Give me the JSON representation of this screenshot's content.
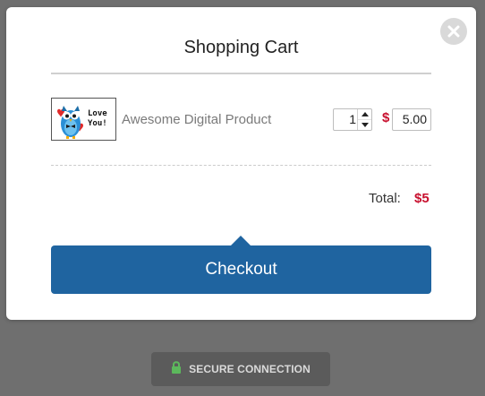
{
  "modal": {
    "title": "Shopping Cart",
    "close_icon": "close-icon"
  },
  "cart": {
    "items": [
      {
        "name": "Awesome Digital Product",
        "thumbnail_text_line1": "Love",
        "thumbnail_text_line2": "You!",
        "quantity": "1",
        "currency_symbol": "$",
        "price": "5.00"
      }
    ],
    "total_label": "Total:",
    "total_value": "$5"
  },
  "checkout": {
    "label": "Checkout"
  },
  "secure": {
    "label": "SECURE CONNECTION",
    "icon": "lock-icon"
  },
  "colors": {
    "backdrop": "#6f6f6f",
    "accent": "#1f64a0",
    "price_red": "#c8102e",
    "lock_green": "#5cb85c"
  }
}
